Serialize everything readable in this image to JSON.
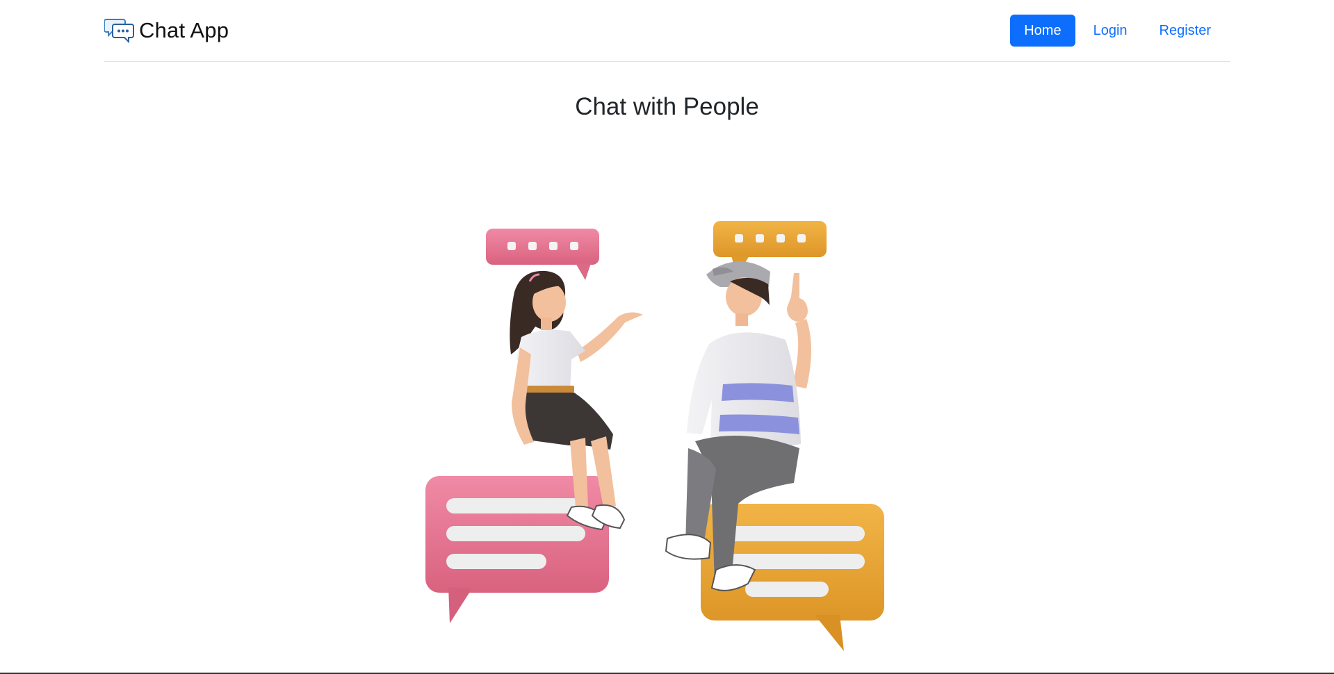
{
  "navbar": {
    "brand_icon": "chat-bubbles-icon",
    "brand_text": "Chat App",
    "links": [
      {
        "label": "Home",
        "active": true
      },
      {
        "label": "Login",
        "active": false
      },
      {
        "label": "Register",
        "active": false
      }
    ]
  },
  "main": {
    "title": "Chat with People",
    "illustration": "two-people-chatting-illustration"
  },
  "colors": {
    "accent": "#0d6efd",
    "pink_bubble": "#e8708f",
    "orange_bubble": "#e9a634"
  }
}
